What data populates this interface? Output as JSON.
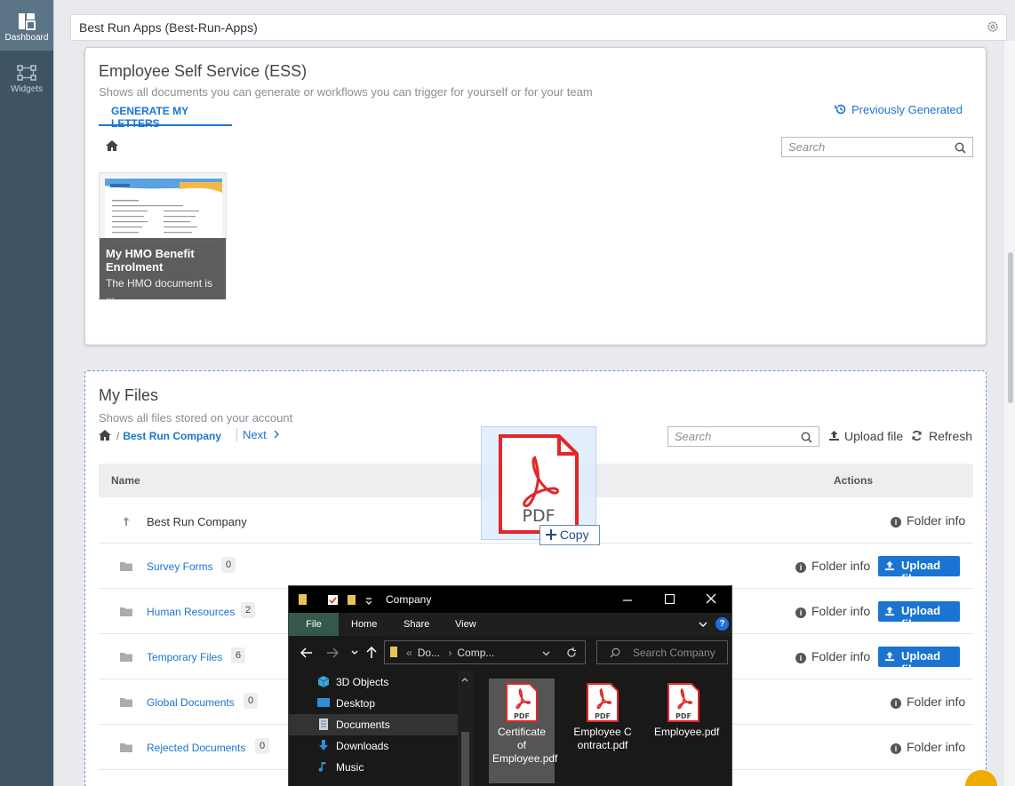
{
  "sidebar": {
    "items": [
      {
        "label": "Dashboard",
        "icon": "dashboard-icon",
        "active": true
      },
      {
        "label": "Widgets",
        "icon": "widgets-icon",
        "active": false
      }
    ]
  },
  "app": {
    "title": "Best Run Apps (Best-Run-Apps)"
  },
  "ess": {
    "title": "Employee Self Service (ESS)",
    "subtitle": "Shows all documents you can generate or workflows you can trigger for yourself or for your team",
    "tab_label": "GENERATE MY LETTERS",
    "previously_generated": "Previously Generated",
    "search_placeholder": "Search",
    "letter": {
      "title": "My HMO Benefit Enrolment",
      "description": "The HMO document is ..."
    }
  },
  "files": {
    "title": "My Files",
    "subtitle": "Shows all files stored on your account",
    "breadcrumb_current": "Best Run Company",
    "breadcrumb_sep": "/",
    "next_label": "Next",
    "search_placeholder": "Search",
    "upload_file": "Upload file",
    "refresh": "Refresh",
    "columns": {
      "name": "Name",
      "actions": "Actions"
    },
    "parent": {
      "name": "Best Run Company",
      "action": "Folder info"
    },
    "folders": [
      {
        "name": "Survey Forms",
        "count": "0",
        "info": "Folder info",
        "upload": "Upload file"
      },
      {
        "name": "Human Resources",
        "count": "2",
        "info": "Folder info",
        "upload": "Upload file"
      },
      {
        "name": "Temporary Files",
        "count": "6",
        "info": "Folder info",
        "upload": "Upload file"
      },
      {
        "name": "Global Documents",
        "count": "0",
        "info": "Folder info",
        "upload": ""
      },
      {
        "name": "Rejected Documents",
        "count": "0",
        "info": "Folder info",
        "upload": ""
      }
    ]
  },
  "drag": {
    "icon_label": "PDF",
    "tooltip": "Copy"
  },
  "explorer": {
    "title": "Company",
    "ribbon": [
      "File",
      "Home",
      "Share",
      "View"
    ],
    "address_prefix": "«",
    "address": [
      "Do...",
      "Comp..."
    ],
    "search_placeholder": "Search Company",
    "nav": [
      "3D Objects",
      "Desktop",
      "Documents",
      "Downloads",
      "Music"
    ],
    "files": [
      {
        "name": "Certificate of Employee.pdf",
        "badge": "PDF"
      },
      {
        "name": "Employee Contract.pdf",
        "badge": "PDF"
      },
      {
        "name": "Employee.pdf",
        "badge": "PDF"
      }
    ]
  },
  "colors": {
    "accent": "#1b74d1",
    "sidebar": "#3e5465",
    "explorer_file_tab": "#34594a",
    "pdf_red": "#e2262a"
  }
}
